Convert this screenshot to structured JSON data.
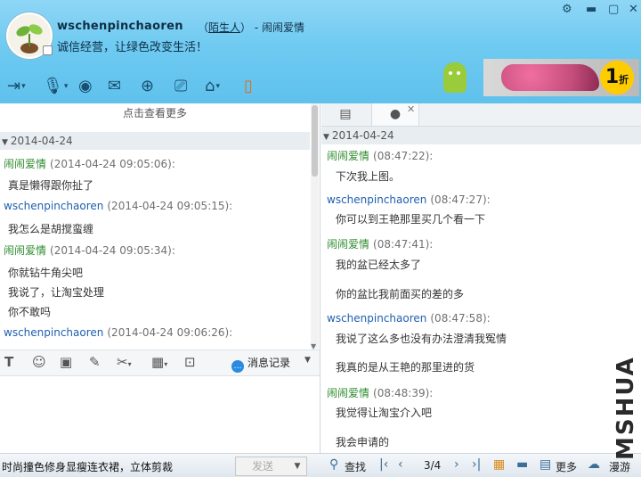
{
  "header": {
    "contact_name": "wschenpinchaoren",
    "relation_open": "（",
    "relation": "陌生人",
    "relation_close": "）",
    "separator": "-",
    "self_name": "闹闹爱情",
    "signature": "诚信经营，让绿色改变生活！",
    "window_controls": [
      "gear-icon",
      "minimize-icon",
      "maximize-icon",
      "close-icon"
    ],
    "ad_number": "1",
    "ad_suffix": "折"
  },
  "toolbar_icons": [
    "file-transfer-icon",
    "voice-icon",
    "video-icon",
    "email-icon",
    "add-contact-icon",
    "screen-share-icon",
    "remote-assist-icon",
    "phone-icon"
  ],
  "left": {
    "view_more": "点击查看更多",
    "date": "2014-04-24",
    "messages": [
      {
        "author": "闹闹爱情",
        "time": "(2014-04-24 09:05:06):",
        "lines": [
          "真是懒得跟你扯了"
        ]
      },
      {
        "author": "wschenpinchaoren",
        "time": "(2014-04-24 09:05:15):",
        "lines": [
          "我怎么是胡搅蛮缠"
        ]
      },
      {
        "author": "闹闹爱情",
        "time": "(2014-04-24 09:05:34):",
        "lines": [
          "你就钻牛角尖吧",
          "我说了，让淘宝处理",
          "你不敢吗"
        ]
      },
      {
        "author": "wschenpinchaoren",
        "time": "(2014-04-24 09:06:26):",
        "lines": []
      }
    ]
  },
  "input_toolbar": {
    "icons": [
      "font-icon",
      "emoji-icon",
      "image-icon",
      "edit-icon",
      "screenshot-icon",
      "calculator-icon",
      "video-icon"
    ],
    "history_label": "消息记录"
  },
  "right": {
    "date": "2014-04-24",
    "messages": [
      {
        "author": "闹闹爱情",
        "time": "(08:47:22):",
        "lines": [
          "下次我上图。"
        ]
      },
      {
        "author": "wschenpinchaoren",
        "time": "(08:47:27):",
        "lines": [
          "你可以到王艳那里买几个看一下"
        ]
      },
      {
        "author": "闹闹爱情",
        "time": "(08:47:41):",
        "lines": [
          "我的盆已经太多了",
          "你的盆比我前面买的差的多"
        ]
      },
      {
        "author": "wschenpinchaoren",
        "time": "(08:47:58):",
        "lines": [
          "我说了这么多也没有办法澄清我冤情",
          "我真的是从王艳的那里进的货"
        ]
      },
      {
        "author": "闹闹爱情",
        "time": "(08:48:39):",
        "lines": [
          "我觉得让淘宝介入吧",
          "我会申请的"
        ]
      }
    ]
  },
  "footer": {
    "ad_text": "时尚撞色修身显瘦连衣裙，立体剪裁",
    "send_label": "发送",
    "find_label": "查找",
    "page_indicator": "3/4",
    "more_label": "更多",
    "roam_label": "漫游"
  },
  "watermark": "MSHUA"
}
